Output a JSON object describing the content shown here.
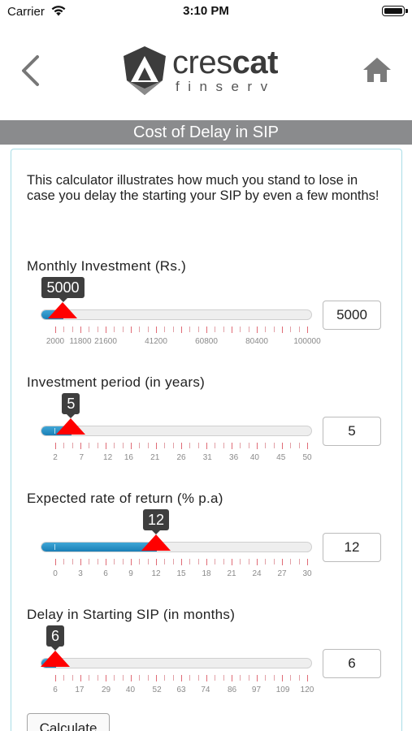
{
  "status_bar": {
    "carrier": "Carrier",
    "time": "3:10 PM"
  },
  "nav": {
    "back_icon": "chevron-left-icon",
    "home_icon": "home-icon"
  },
  "logo": {
    "brand_light": "cres",
    "brand_bold": "cat",
    "tagline": "finserv"
  },
  "title": "Cost of Delay in SIP",
  "intro": "This calculator illustrates how much you stand to lose in case you delay the starting your SIP by even a few months!",
  "colors": {
    "accent": "#1a7fb6",
    "handle": "#ff0000",
    "title_bar": "#8a8b8d",
    "tick": "#e06a75"
  },
  "sliders": [
    {
      "label": "Monthly Investment (Rs.)",
      "value": "5000",
      "min": 2000,
      "max": 100000,
      "current": 5000,
      "ticks": [
        "2000",
        "11800",
        "21600",
        "41200",
        "60800",
        "80400",
        "100000"
      ],
      "tick_values": [
        2000,
        11800,
        21600,
        41200,
        60800,
        80400,
        100000
      ]
    },
    {
      "label": "Investment period (in years)",
      "value": "5",
      "min": 2,
      "max": 50,
      "current": 5,
      "ticks": [
        "2",
        "7",
        "12",
        "16",
        "21",
        "26",
        "31",
        "36",
        "40",
        "45",
        "50"
      ],
      "tick_values": [
        2,
        7,
        12,
        16,
        21,
        26,
        31,
        36,
        40,
        45,
        50
      ]
    },
    {
      "label": "Expected rate of return (% p.a)",
      "value": "12",
      "min": 0,
      "max": 30,
      "current": 12,
      "ticks": [
        "0",
        "3",
        "6",
        "9",
        "12",
        "15",
        "18",
        "21",
        "24",
        "27",
        "30"
      ],
      "tick_values": [
        0,
        3,
        6,
        9,
        12,
        15,
        18,
        21,
        24,
        27,
        30
      ]
    },
    {
      "label": "Delay in Starting SIP (in months)",
      "value": "6",
      "min": 6,
      "max": 120,
      "current": 6,
      "ticks": [
        "6",
        "17",
        "29",
        "40",
        "52",
        "63",
        "74",
        "86",
        "97",
        "109",
        "120"
      ],
      "tick_values": [
        6,
        17,
        29,
        40,
        52,
        63,
        74,
        86,
        97,
        109,
        120
      ]
    }
  ],
  "calculate_label": "Calculate"
}
